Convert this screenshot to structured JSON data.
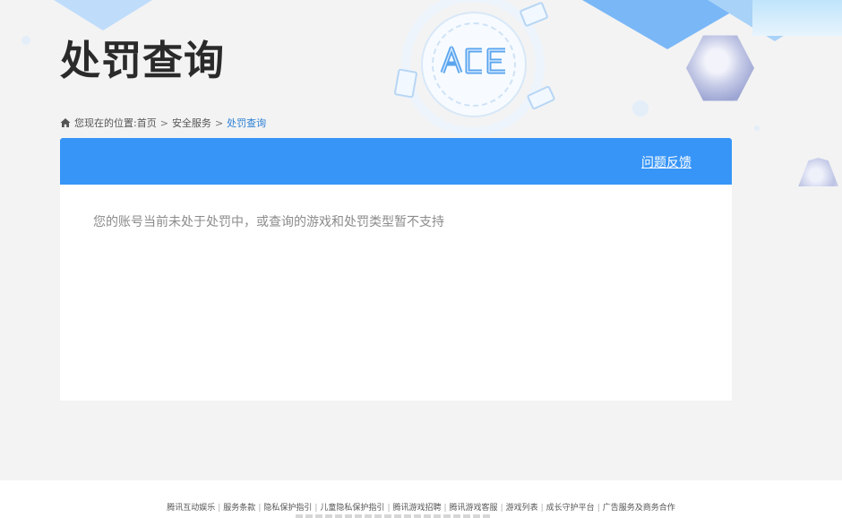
{
  "page": {
    "title": "处罚查询"
  },
  "breadcrumb": {
    "label": "您现在的位置:",
    "items": [
      "首页",
      "安全服务",
      "处罚查询"
    ],
    "separator": ">"
  },
  "panel": {
    "feedback_label": "问题反馈",
    "message": "您的账号当前未处于处罚中，或查询的游戏和处罚类型暂不支持"
  },
  "logo": {
    "text": "ACE"
  },
  "footer": {
    "links": [
      "腾讯互动娱乐",
      "服务条款",
      "隐私保护指引",
      "儿童隐私保护指引",
      "腾讯游戏招聘",
      "腾讯游戏客服",
      "游戏列表",
      "成长守护平台",
      "广告服务及商务合作"
    ],
    "separator": "|"
  },
  "colors": {
    "header_blue": "#3795f7",
    "breadcrumb_active": "#2a7fd6",
    "page_background": "#f3f3f3"
  },
  "icons": {
    "home": "home-icon"
  }
}
